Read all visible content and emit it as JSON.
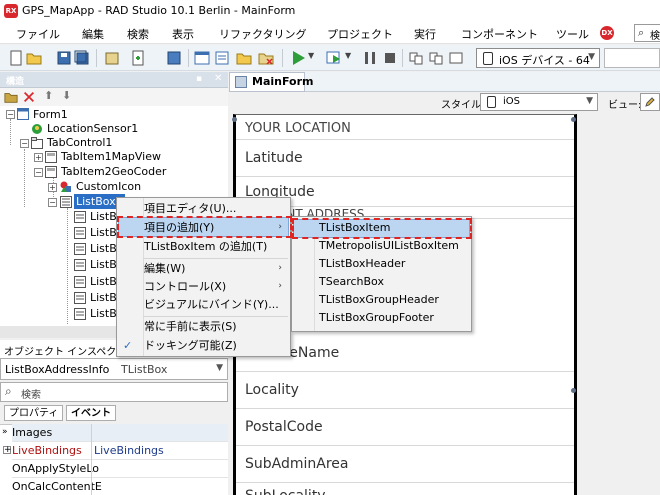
{
  "window": {
    "title": "GPS_MapApp - RAD Studio 10.1 Berlin - MainForm",
    "logo_text": "RX"
  },
  "menubar": {
    "items": [
      "ファイル",
      "編集",
      "検索",
      "表示",
      "リファクタリング",
      "プロジェクト",
      "実行",
      "コンポーネント",
      "ツール"
    ],
    "search_label": "検"
  },
  "toolbar": {
    "platform": "iOS デバイス - 64"
  },
  "structure_panel": {
    "title": "構造",
    "tree": [
      {
        "label": "Form1"
      },
      {
        "label": "LocationSensor1"
      },
      {
        "label": "TabControl1"
      },
      {
        "label": "TabItem1MapView"
      },
      {
        "label": "TabItem2GeoCoder"
      },
      {
        "label": "CustomIcon"
      },
      {
        "label": "ListBoxA"
      },
      {
        "label": "ListB"
      },
      {
        "label": "ListB"
      },
      {
        "label": "ListB"
      },
      {
        "label": "ListB"
      },
      {
        "label": "ListB"
      },
      {
        "label": "ListB"
      },
      {
        "label": "ListB"
      }
    ]
  },
  "object_inspector": {
    "title": "オブジェクト インスペク",
    "selected_name": "ListBoxAddressInfo",
    "selected_type": "TListBox",
    "search_placeholder": "検索",
    "tabs": [
      "プロパティ",
      "イベント"
    ],
    "rows": [
      {
        "name": "Images",
        "value": ""
      },
      {
        "name": "LiveBindings",
        "value": "LiveBindings"
      },
      {
        "name": "OnApplyStyleLo",
        "value": ""
      },
      {
        "name": "OnCalcContentE",
        "value": ""
      }
    ]
  },
  "designer": {
    "tab_label": "MainForm",
    "style_label": "スタイル:",
    "style_value": "iOS",
    "view_label": "ビュー:",
    "listbox_items": [
      "YOUR LOCATION",
      "Latitude",
      "Longitude",
      "FeatureName",
      "Locality",
      "PostalCode",
      "SubAdminArea",
      "SubLocality"
    ],
    "partial_header": "CURRENT ADDRESS"
  },
  "context_menu": {
    "items": [
      {
        "label": "項目エディタ(U)...",
        "submenu": false
      },
      {
        "label": "項目の追加(Y)",
        "submenu": true
      },
      {
        "label": "TListBoxItem の追加(T)",
        "submenu": false
      },
      {
        "label": "編集(W)",
        "submenu": true
      },
      {
        "label": "コントロール(X)",
        "submenu": true
      },
      {
        "label": "ビジュアルにバインド(Y)...",
        "submenu": false
      },
      {
        "label": "常に手前に表示(S)",
        "submenu": false
      },
      {
        "label": "ドッキング可能(Z)",
        "submenu": false,
        "checked": true
      }
    ],
    "check_mark": "✓"
  },
  "submenu": {
    "items": [
      "TListBoxItem",
      "TMetropolisUIListBoxItem",
      "TListBoxHeader",
      "TSearchBox",
      "TListBoxGroupHeader",
      "TListBoxGroupFooter"
    ]
  },
  "colors": {
    "highlight": "#bcd6f1",
    "annotation_red": "#e02424",
    "accent_red": "#d9272e",
    "play_green": "#2e9e3b"
  }
}
